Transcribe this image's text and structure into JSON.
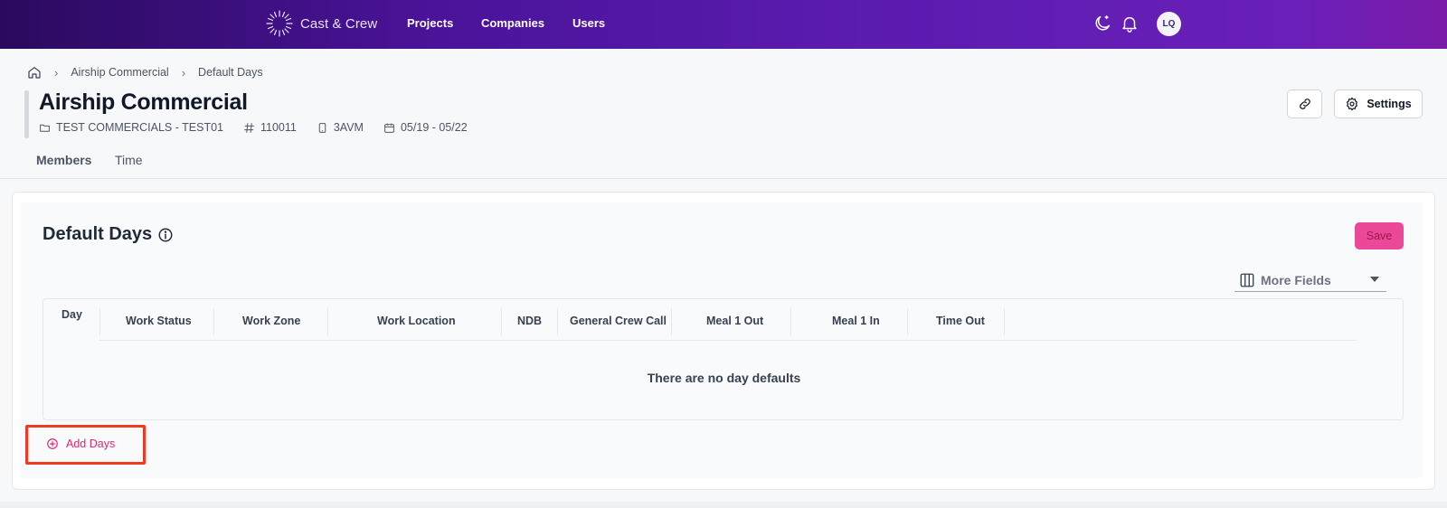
{
  "topbar": {
    "logo_text": "Cast & Crew",
    "nav": [
      "Projects",
      "Companies",
      "Users"
    ],
    "avatar_initials": "LQ"
  },
  "breadcrumb": {
    "items": [
      "Airship Commercial",
      "Default Days"
    ]
  },
  "project": {
    "title": "Airship Commercial",
    "company": "TEST COMMERCIALS - TEST01",
    "number": "110011",
    "code": "3AVM",
    "dates": "05/19 - 05/22"
  },
  "header_buttons": {
    "settings_label": "Settings"
  },
  "tabs": [
    "Members",
    "Time"
  ],
  "section": {
    "title": "Default Days",
    "save_label": "Save",
    "more_fields_label": "More Fields"
  },
  "table": {
    "columns": [
      "Day",
      "Work Status",
      "Work Zone",
      "Work Location",
      "NDB",
      "General Crew Call",
      "Meal 1 Out",
      "Meal 1 In",
      "Time Out"
    ],
    "empty_message": "There are no day defaults"
  },
  "add_days_label": "Add Days",
  "colors": {
    "accent": "#ec4899",
    "topbar_start": "#2b0a5e",
    "topbar_end": "#7a1aa8",
    "highlight": "#ef3b24"
  }
}
